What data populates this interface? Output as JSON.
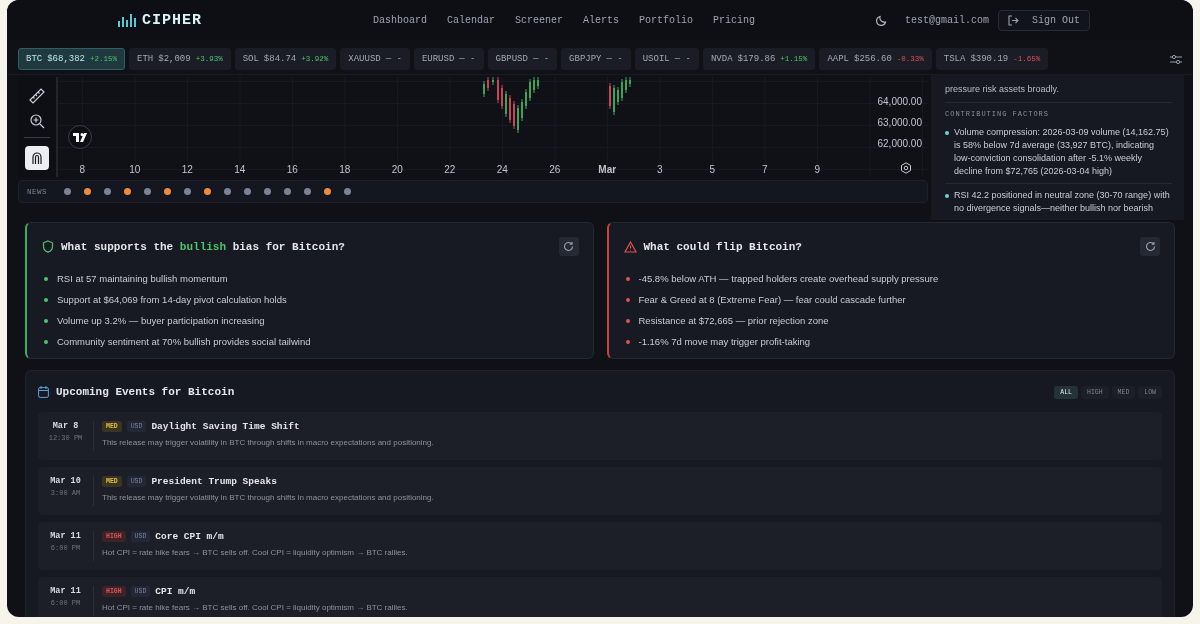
{
  "header": {
    "brand": "CIPHER",
    "nav": [
      {
        "label": "Dashboard"
      },
      {
        "label": "Calendar"
      },
      {
        "label": "Screener"
      },
      {
        "label": "Alerts"
      },
      {
        "label": "Portfolio"
      },
      {
        "label": "Pricing"
      }
    ],
    "email": "test@gmail.com",
    "sign_out": "Sign Out"
  },
  "ticker": [
    {
      "symbol": "BTC",
      "price": "$68,382",
      "change": "+2.15%",
      "negative": false,
      "selected": true
    },
    {
      "symbol": "ETH",
      "price": "$2,009",
      "change": "+3.93%",
      "negative": false,
      "selected": false
    },
    {
      "symbol": "SOL",
      "price": "$84.74",
      "change": "+3.92%",
      "negative": false,
      "selected": false
    },
    {
      "symbol": "XAUUSD",
      "price": "— -",
      "selected": false
    },
    {
      "symbol": "EURUSD",
      "price": "— -",
      "selected": false
    },
    {
      "symbol": "GBPUSD",
      "price": "— -",
      "selected": false
    },
    {
      "symbol": "GBPJPY",
      "price": "— -",
      "selected": false
    },
    {
      "symbol": "USOIL",
      "price": "— -",
      "selected": false
    },
    {
      "symbol": "NVDA",
      "price": "$179.86",
      "change": "+1.15%",
      "negative": false,
      "selected": false
    },
    {
      "symbol": "AAPL",
      "price": "$256.60",
      "change": "-0.33%",
      "negative": true,
      "selected": false
    },
    {
      "symbol": "TSLA",
      "price": "$390.19",
      "change": "-1.65%",
      "negative": true,
      "selected": false
    }
  ],
  "chart": {
    "y_labels": [
      "64,000.00",
      "63,000.00",
      "62,000.00"
    ],
    "x_labels": [
      "8",
      "10",
      "12",
      "14",
      "16",
      "18",
      "20",
      "22",
      "24",
      "26",
      "Mar",
      "3",
      "5",
      "7",
      "9"
    ],
    "magnet_on": true
  },
  "news": {
    "label": "NEWS",
    "dots": [
      {
        "color": "#7b8294"
      },
      {
        "color": "#f08a3c"
      },
      {
        "color": "#7b8294"
      },
      {
        "color": "#f08a3c"
      },
      {
        "color": "#7b8294"
      },
      {
        "color": "#f08a3c"
      },
      {
        "color": "#7b8294"
      },
      {
        "color": "#f08a3c"
      },
      {
        "color": "#7b8294"
      },
      {
        "color": "#7b8294"
      },
      {
        "color": "#7b8294"
      },
      {
        "color": "#7b8294"
      },
      {
        "color": "#7b8294"
      },
      {
        "color": "#f08a3c"
      },
      {
        "color": "#7b8294"
      }
    ]
  },
  "analysis": {
    "summary_tail": "pressure risk assets broadly.",
    "factors_heading": "CONTRIBUTING FACTORS",
    "factors": [
      "Volume compression: 2026-03-09 volume (14,162.75) is 58% below 7d average (33,927 BTC), indicating low-conviction consolidation after -5.1% weekly decline from $72,765 (2026-03-04 high)",
      "RSI 42.2 positioned in neutral zone (30-70 range) with no divergence signals—neither bullish nor bearish"
    ]
  },
  "cards": [
    {
      "kind": "bull",
      "title_before": "What supports the ",
      "title_highlight": "bullish",
      "title_after": " bias for Bitcoin?",
      "points": [
        "RSI at 57 maintaining bullish momentum",
        "Support at $64,069 from 14-day pivot calculation holds",
        "Volume up 3.2% — buyer participation increasing",
        "Community sentiment at 70% bullish provides social tailwind"
      ]
    },
    {
      "kind": "bear",
      "title_before": "What could flip Bitcoin?",
      "points": [
        "-45.8% below ATH — trapped holders create overhead supply pressure",
        "Fear & Greed at 8 (Extreme Fear) — fear could cascade further",
        "Resistance at $72,665 — prior rejection zone",
        "-1.16% 7d move may trigger profit-taking"
      ]
    }
  ],
  "events": {
    "title": "Upcoming Events for Bitcoin",
    "filters": [
      {
        "label": "ALL",
        "selected": true
      },
      {
        "label": "HIGH",
        "selected": false
      },
      {
        "label": "MED",
        "selected": false
      },
      {
        "label": "LOW",
        "selected": false
      }
    ],
    "items": [
      {
        "date": "Mar 8",
        "time": "12:30 PM",
        "impact": "MED",
        "currency": "USD",
        "title": "Daylight Saving Time Shift",
        "description": "This release may trigger volatility in BTC through shifts in macro expectations and positioning."
      },
      {
        "date": "Mar 10",
        "time": "3:00 AM",
        "impact": "MED",
        "currency": "USD",
        "title": "President Trump Speaks",
        "description": "This release may trigger volatility in BTC through shifts in macro expectations and positioning."
      },
      {
        "date": "Mar 11",
        "time": "6:00 PM",
        "impact": "HIGH",
        "currency": "USD",
        "title": "Core CPI m/m",
        "description": "Hot CPI = rate hike fears → BTC sells off. Cool CPI = liquidity optimism → BTC rallies."
      },
      {
        "date": "Mar 11",
        "time": "6:00 PM",
        "impact": "HIGH",
        "currency": "USD",
        "title": "CPI m/m",
        "description": "Hot CPI = rate hike fears → BTC sells off. Cool CPI = liquidity optimism → BTC rallies."
      }
    ]
  }
}
